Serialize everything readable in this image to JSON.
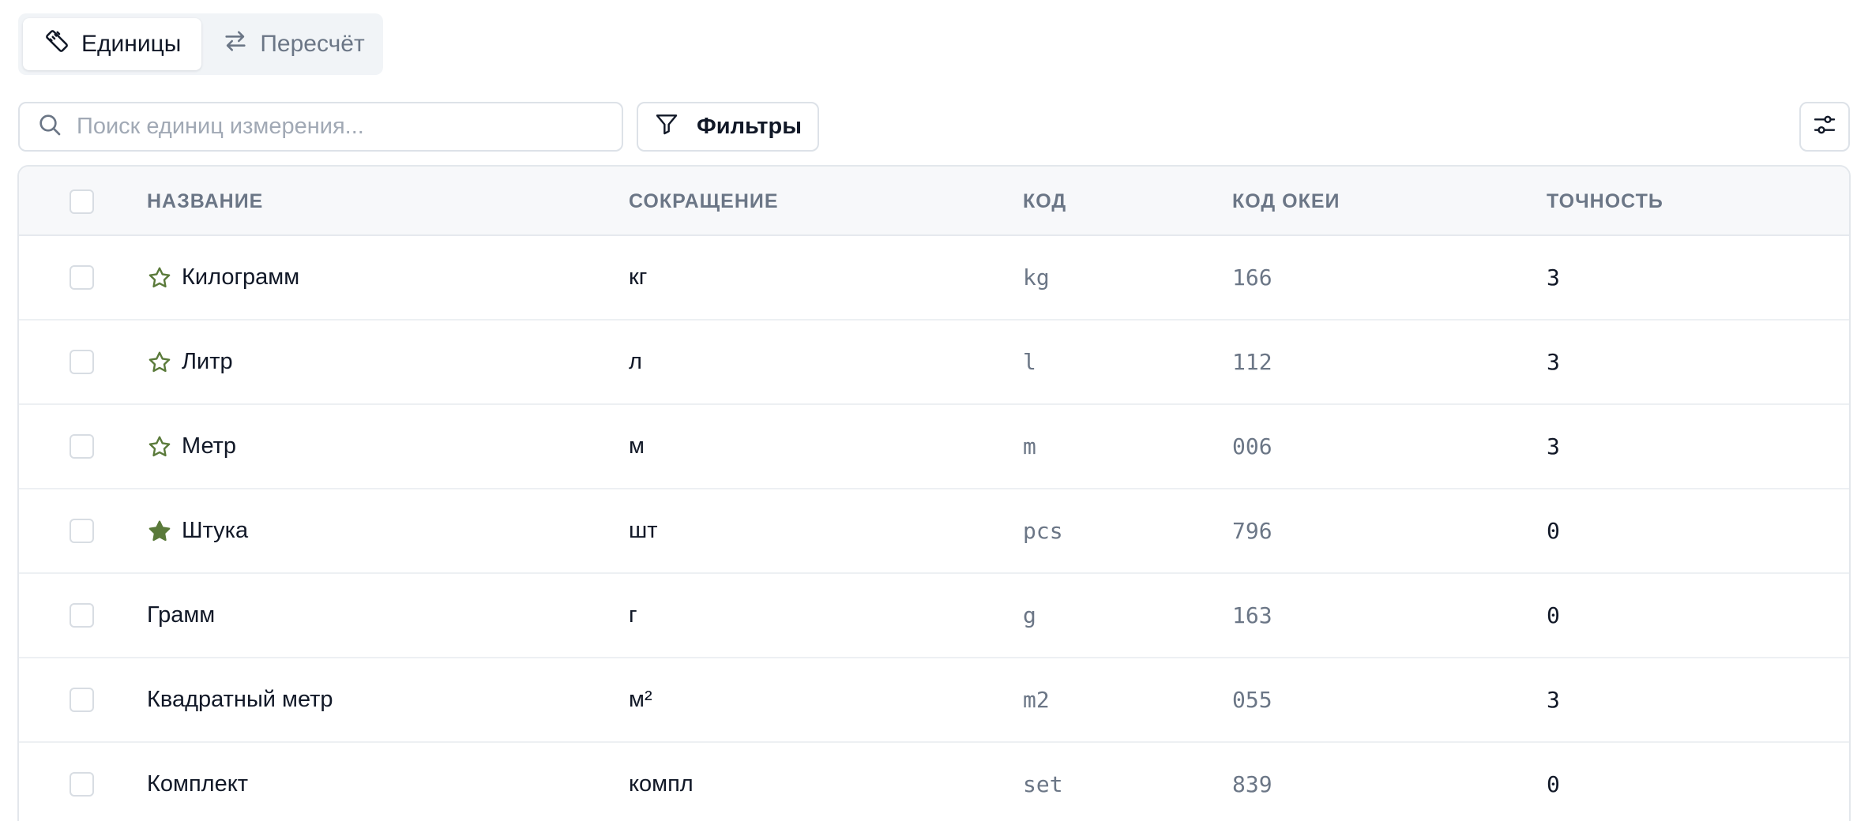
{
  "tabs": [
    {
      "label": "Единицы",
      "icon": "ruler-icon",
      "active": true
    },
    {
      "label": "Пересчёт",
      "icon": "arrows-exchange-icon",
      "active": false
    }
  ],
  "search": {
    "placeholder": "Поиск единиц измерения..."
  },
  "filters": {
    "label": "Фильтры"
  },
  "table": {
    "columns": [
      "НАЗВАНИЕ",
      "СОКРАЩЕНИЕ",
      "КОД",
      "КОД ОКЕИ",
      "ТОЧНОСТЬ"
    ],
    "rows": [
      {
        "name": "Килограмм",
        "abbr": "кг",
        "code": "kg",
        "okei": "166",
        "precision": "3",
        "star": "outline"
      },
      {
        "name": "Литр",
        "abbr": "л",
        "code": "l",
        "okei": "112",
        "precision": "3",
        "star": "outline"
      },
      {
        "name": "Метр",
        "abbr": "м",
        "code": "m",
        "okei": "006",
        "precision": "3",
        "star": "outline"
      },
      {
        "name": "Штука",
        "abbr": "шт",
        "code": "pcs",
        "okei": "796",
        "precision": "0",
        "star": "filled"
      },
      {
        "name": "Грамм",
        "abbr": "г",
        "code": "g",
        "okei": "163",
        "precision": "0",
        "star": "none"
      },
      {
        "name": "Квадратный метр",
        "abbr": "м²",
        "code": "m2",
        "okei": "055",
        "precision": "3",
        "star": "none"
      },
      {
        "name": "Комплект",
        "abbr": "компл",
        "code": "set",
        "okei": "839",
        "precision": "0",
        "star": "none"
      }
    ]
  },
  "colors": {
    "star": "#5a7a3a",
    "muted": "#6b7686",
    "border": "#dde2e8"
  }
}
